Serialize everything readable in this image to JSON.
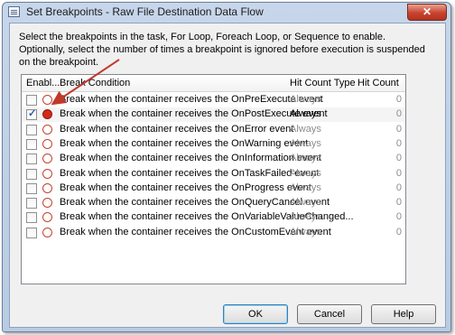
{
  "window": {
    "title": "Set Breakpoints - Raw File Destination Data Flow",
    "close_label": "✕"
  },
  "description": "Select the breakpoints in the task, For Loop, Foreach Loop, or Sequence to enable. Optionally, select the number of times a breakpoint is ignored before execution is suspended on the breakpoint.",
  "grid": {
    "columns": {
      "enabled": "Enabl...",
      "condition": "Break Condition",
      "hit_count_type": "Hit Count Type",
      "hit_count": "Hit Count"
    },
    "rows": [
      {
        "enabled": false,
        "condition": "Break when the container receives the OnPreExecute event",
        "hit_count_type": "Always",
        "hit_count": "0"
      },
      {
        "enabled": true,
        "condition": "Break when the container receives the OnPostExecute event",
        "hit_count_type": "Always",
        "hit_count": "0"
      },
      {
        "enabled": false,
        "condition": "Break when the container receives the OnError event",
        "hit_count_type": "Always",
        "hit_count": "0"
      },
      {
        "enabled": false,
        "condition": "Break when the container receives the OnWarning event",
        "hit_count_type": "Always",
        "hit_count": "0"
      },
      {
        "enabled": false,
        "condition": "Break when the container receives the OnInformation event",
        "hit_count_type": "Always",
        "hit_count": "0"
      },
      {
        "enabled": false,
        "condition": "Break when the container receives the OnTaskFailed event",
        "hit_count_type": "Always",
        "hit_count": "0"
      },
      {
        "enabled": false,
        "condition": "Break when the container receives the OnProgress event",
        "hit_count_type": "Always",
        "hit_count": "0"
      },
      {
        "enabled": false,
        "condition": "Break when the container receives the OnQueryCancel event",
        "hit_count_type": "Always",
        "hit_count": "0"
      },
      {
        "enabled": false,
        "condition": "Break when the container receives the OnVariableValueChanged...",
        "hit_count_type": "Always",
        "hit_count": "0"
      },
      {
        "enabled": false,
        "condition": "Break when the container receives the OnCustomEvent event",
        "hit_count_type": "Always",
        "hit_count": "0"
      }
    ]
  },
  "buttons": {
    "ok": "OK",
    "cancel": "Cancel",
    "help": "Help"
  },
  "colors": {
    "annotation_arrow": "#c0392b",
    "breakpoint_on": "#d32a1a",
    "breakpoint_off_border": "#c4422e"
  }
}
